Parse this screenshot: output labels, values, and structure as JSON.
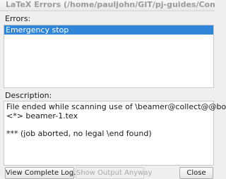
{
  "window": {
    "title": "LaTeX Errors (/home/pauljohn/GIT/pj-guides/Computing-HO..."
  },
  "errors": {
    "label": "Errors:",
    "items": [
      "Emergency stop"
    ]
  },
  "description": {
    "label": "Description:",
    "lines": [
      "File ended while scanning use of \\beamer@collect@@body.",
      "<*> beamer-1.tex",
      "",
      "*** (job aborted, no legal \\end found)"
    ]
  },
  "buttons": {
    "view_log": "View Complete Log...",
    "show_output": "Show Output Anyway",
    "close": "Close"
  },
  "colors": {
    "selection": "#2f86d8"
  }
}
